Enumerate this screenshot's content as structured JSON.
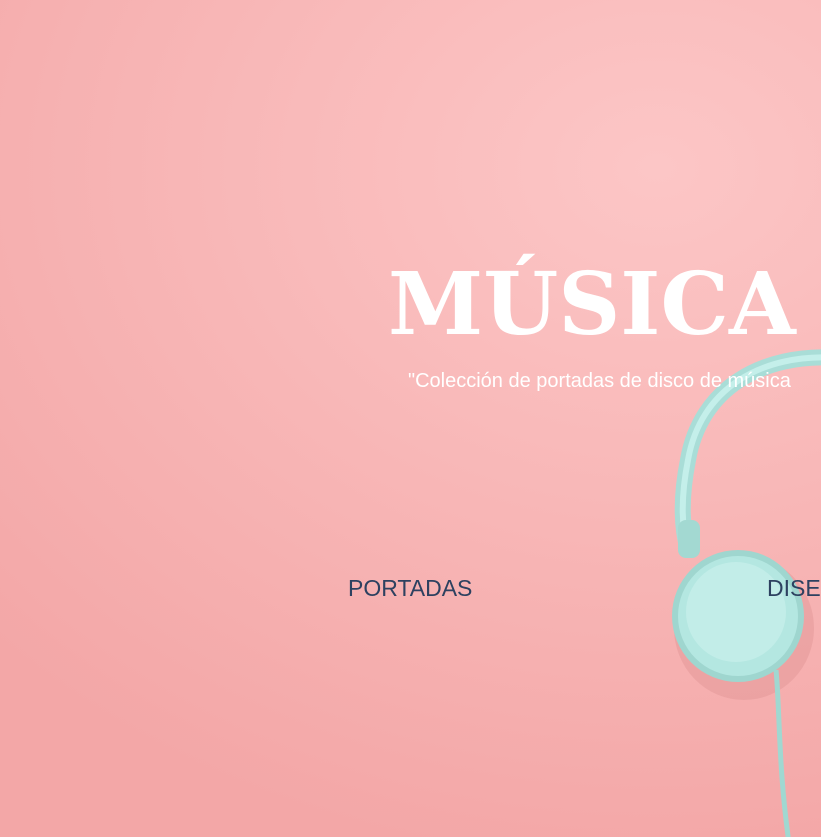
{
  "hero": {
    "title": "MÚSICA Y",
    "subtitle": "\"Colección de portadas de disco de música"
  },
  "nav": {
    "items": [
      {
        "label": "PORTADAS"
      },
      {
        "label": "DISE"
      }
    ]
  },
  "colors": {
    "background": "#f6b0b0",
    "title_text": "#ffffff",
    "nav_text": "#2d4160",
    "headphones": "#aee5df"
  }
}
